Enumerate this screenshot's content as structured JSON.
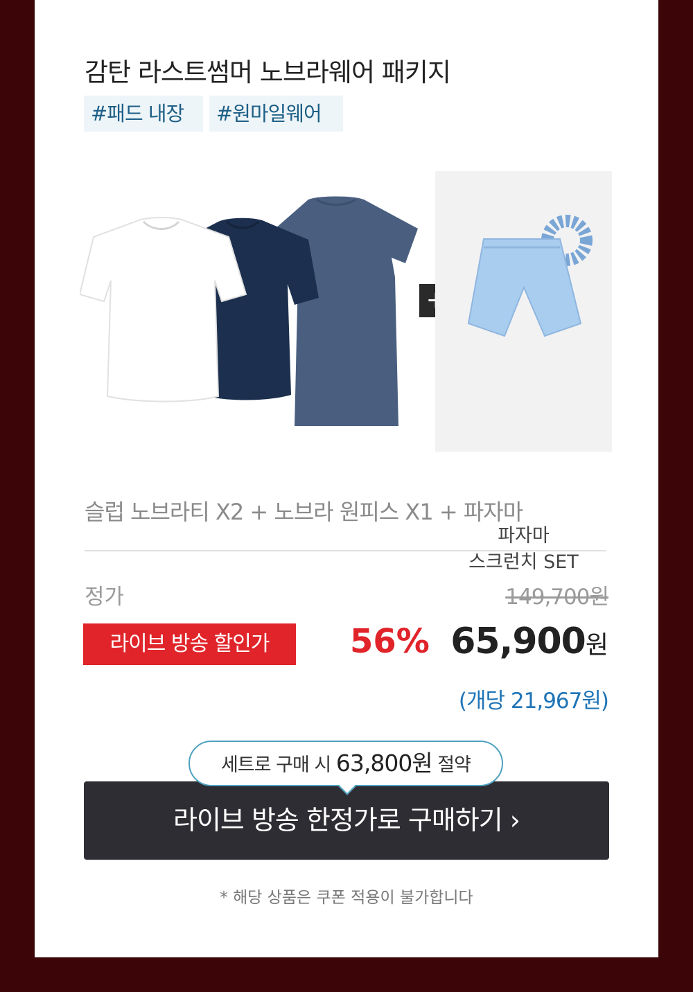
{
  "title": "감탄 라스트썸머 노브라웨어 패키지",
  "tags": [
    "#패드 내장",
    "#원마일웨어"
  ],
  "bonus": {
    "line1": "파자마",
    "line2": "스크런치 SET",
    "plus": "+"
  },
  "composition": "슬럽 노브라티 X2 + 노브라 원피스 X1 + 파자마",
  "pricing": {
    "orig_label": "정가",
    "orig_price": "149,700원",
    "live_label": "라이브 방송 할인가",
    "discount": "56%",
    "sale_price": "65,900",
    "sale_currency": "원",
    "per_unit": "(개당 21,967원)"
  },
  "savings": {
    "prefix": "세트로 구매 시",
    "amount": "63,800원",
    "suffix": "절약"
  },
  "cta_label": "라이브 방송 한정가로 구매하기 ›",
  "notice": "* 해당 상품은 쿠폰 적용이 불가합니다",
  "colors": {
    "background": "#3c0608",
    "accent_red": "#e0242a",
    "accent_blue": "#1f74b6",
    "tag_bg": "#eef5f8",
    "cta_bg": "#2d2d33",
    "shirt_white": "#ffffff",
    "shirt_navy": "#1c2f4e",
    "dress_blue": "#4a5f80",
    "pajama_blue": "#a9cdef"
  }
}
